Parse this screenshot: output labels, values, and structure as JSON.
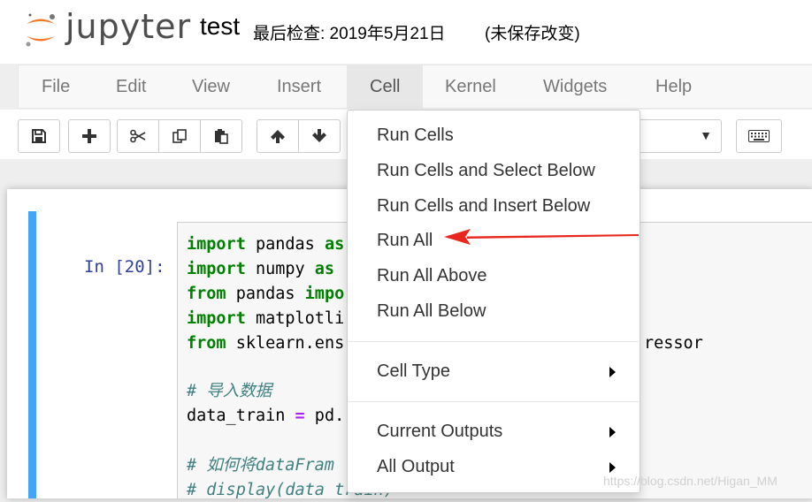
{
  "header": {
    "logo_text": "jupyter",
    "notebook_name": "test",
    "checkpoint": "最后检查: 2019年5月21日",
    "unsaved_status": "(未保存改变)"
  },
  "menubar": {
    "items": [
      {
        "label": "File"
      },
      {
        "label": "Edit"
      },
      {
        "label": "View"
      },
      {
        "label": "Insert"
      },
      {
        "label": "Cell"
      },
      {
        "label": "Kernel"
      },
      {
        "label": "Widgets"
      },
      {
        "label": "Help"
      }
    ],
    "active": "Cell"
  },
  "toolbar": {
    "buttons": [
      {
        "icon": "save-icon"
      },
      {
        "icon": "plus-icon"
      },
      {
        "icon": "scissors-icon"
      },
      {
        "icon": "copy-icon"
      },
      {
        "icon": "paste-icon"
      },
      {
        "icon": "arrow-up-icon"
      },
      {
        "icon": "arrow-down-icon"
      },
      {
        "icon": "keyboard-icon"
      }
    ]
  },
  "cell_menu": {
    "items": [
      {
        "label": "Run Cells"
      },
      {
        "label": "Run Cells and Select Below"
      },
      {
        "label": "Run Cells and Insert Below"
      },
      {
        "label": "Run All"
      },
      {
        "label": "Run All Above"
      },
      {
        "label": "Run All Below"
      },
      {
        "label": "Cell Type"
      },
      {
        "label": "Current Outputs"
      },
      {
        "label": "All Output"
      }
    ]
  },
  "cell": {
    "prompt": "In  [20]:",
    "code_lines": [
      {
        "kw": "import",
        "rest": " pandas ",
        "kw2": "as"
      },
      {
        "kw": "import",
        "rest": " numpy ",
        "kw2": "as"
      },
      {
        "kw": "from",
        "rest": " pandas ",
        "kw2": "impo"
      },
      {
        "kw": "import",
        "rest": " matplotli"
      },
      {
        "kw": "from",
        "rest": " sklearn.ens",
        "tail": "ressor"
      },
      {
        "comment": "# 导入数据"
      },
      {
        "pre": "data_train ",
        "op": "=",
        "post": " pd."
      },
      {
        "comment": "# 如何将dataFram"
      },
      {
        "comment": "# display(data train)"
      }
    ]
  },
  "colors": {
    "cell_border": "#42a5f5",
    "keyword": "#008000",
    "comment": "#408080",
    "prompt": "#303f9f",
    "annotation_arrow": "#e8271e"
  },
  "watermark": "https://blog.csdn.net/Higan_MM"
}
